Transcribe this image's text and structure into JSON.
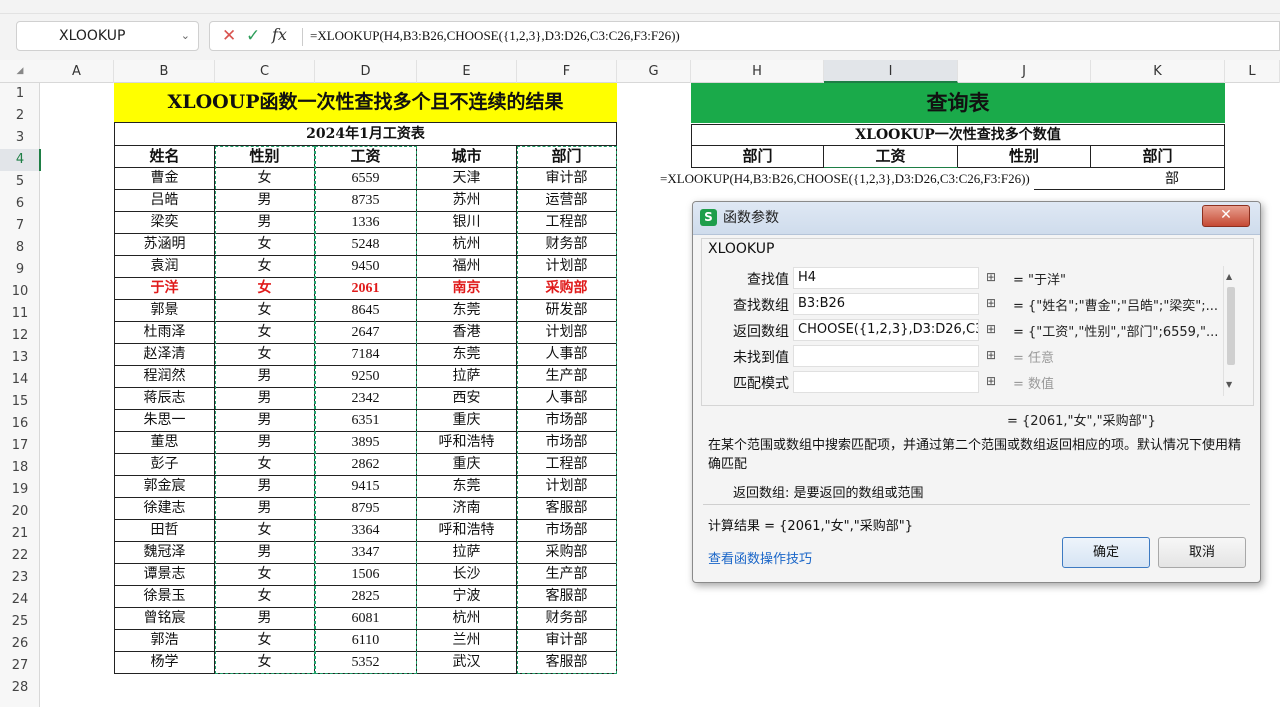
{
  "name_box": "XLOOKUP",
  "formula_bar": "=XLOOKUP(H4,B3:B26,CHOOSE({1,2,3},D3:D26,C3:C26,F3:F26))",
  "columns": [
    "A",
    "B",
    "C",
    "D",
    "E",
    "F",
    "G",
    "H",
    "I",
    "J",
    "K",
    "L"
  ],
  "rows": [
    "1",
    "2",
    "3",
    "4",
    "5",
    "6",
    "7",
    "8",
    "9",
    "10",
    "11",
    "12",
    "13",
    "14",
    "15",
    "16",
    "17",
    "18",
    "19",
    "20",
    "21",
    "22",
    "23",
    "24",
    "25",
    "26",
    "27",
    "28"
  ],
  "left_table": {
    "banner": "XLOOUP函数一次性查找多个且不连续的结果",
    "subtitle": "2024年1月工资表",
    "headers": [
      "姓名",
      "性别",
      "工资",
      "城市",
      "部门"
    ],
    "rows": [
      [
        "曹金",
        "女",
        "6559",
        "天津",
        "审计部"
      ],
      [
        "吕皓",
        "男",
        "8735",
        "苏州",
        "运营部"
      ],
      [
        "梁奕",
        "男",
        "1336",
        "银川",
        "工程部"
      ],
      [
        "苏涵明",
        "女",
        "5248",
        "杭州",
        "财务部"
      ],
      [
        "袁润",
        "女",
        "9450",
        "福州",
        "计划部"
      ],
      [
        "于洋",
        "女",
        "2061",
        "南京",
        "采购部"
      ],
      [
        "郭景",
        "女",
        "8645",
        "东莞",
        "研发部"
      ],
      [
        "杜雨泽",
        "女",
        "2647",
        "香港",
        "计划部"
      ],
      [
        "赵泽清",
        "女",
        "7184",
        "东莞",
        "人事部"
      ],
      [
        "程润然",
        "男",
        "9250",
        "拉萨",
        "生产部"
      ],
      [
        "蒋辰志",
        "男",
        "2342",
        "西安",
        "人事部"
      ],
      [
        "朱思一",
        "男",
        "6351",
        "重庆",
        "市场部"
      ],
      [
        "董思",
        "男",
        "3895",
        "呼和浩特",
        "市场部"
      ],
      [
        "彭子",
        "女",
        "2862",
        "重庆",
        "工程部"
      ],
      [
        "郭金宸",
        "男",
        "9415",
        "东莞",
        "计划部"
      ],
      [
        "徐建志",
        "男",
        "8795",
        "济南",
        "客服部"
      ],
      [
        "田哲",
        "女",
        "3364",
        "呼和浩特",
        "市场部"
      ],
      [
        "魏冠泽",
        "男",
        "3347",
        "拉萨",
        "采购部"
      ],
      [
        "谭景志",
        "女",
        "1506",
        "长沙",
        "生产部"
      ],
      [
        "徐景玉",
        "女",
        "2825",
        "宁波",
        "客服部"
      ],
      [
        "曾铭宸",
        "男",
        "6081",
        "杭州",
        "财务部"
      ],
      [
        "郭浩",
        "女",
        "6110",
        "兰州",
        "审计部"
      ],
      [
        "杨学",
        "女",
        "5352",
        "武汉",
        "客服部"
      ]
    ]
  },
  "right_table": {
    "banner": "查询表",
    "subtitle": "XLOOKUP一次性查找多个数值",
    "headers": [
      "部门",
      "工资",
      "性别",
      "部门"
    ],
    "row4_formula": "=XLOOKUP(H4,B3:B26,CHOOSE({1,2,3},D3:D26,C3:C26,F3:F26))",
    "row4_tail": "部"
  },
  "dialog": {
    "title": "函数参数",
    "close": "✕",
    "function_name": "XLOOKUP",
    "params": [
      {
        "label": "查找值",
        "input": "H4",
        "value": "= \"于洋\"",
        "gray": false
      },
      {
        "label": "查找数组",
        "input": "B3:B26",
        "value": "= {\"姓名\";\"曹金\";\"吕皓\";\"梁奕\";...",
        "gray": false
      },
      {
        "label": "返回数组",
        "input": "CHOOSE({1,2,3},D3:D26,C3:",
        "value": "= {\"工资\",\"性别\",\"部门\";6559,\"...",
        "gray": false
      },
      {
        "label": "未找到值",
        "input": "",
        "value": "= 任意",
        "gray": true
      },
      {
        "label": "匹配模式",
        "input": "",
        "value": "= 数值",
        "gray": true
      }
    ],
    "result_line": "= {2061,\"女\",\"采购部\"}",
    "description": "在某个范围或数组中搜索匹配项，并通过第二个范围或数组返回相应的项。默认情况下使用精确匹配",
    "return_desc": "返回数组:  是要返回的数组或范围",
    "calc_result": "计算结果 = {2061,\"女\",\"采购部\"}",
    "tips_link": "查看函数操作技巧",
    "ok": "确定",
    "cancel": "取消"
  },
  "colors": {
    "banner_yellow": "#ffff00",
    "banner_green": "#1aaa4a",
    "highlight_red": "#e01b1b",
    "selection_green": "#1e7e45"
  }
}
